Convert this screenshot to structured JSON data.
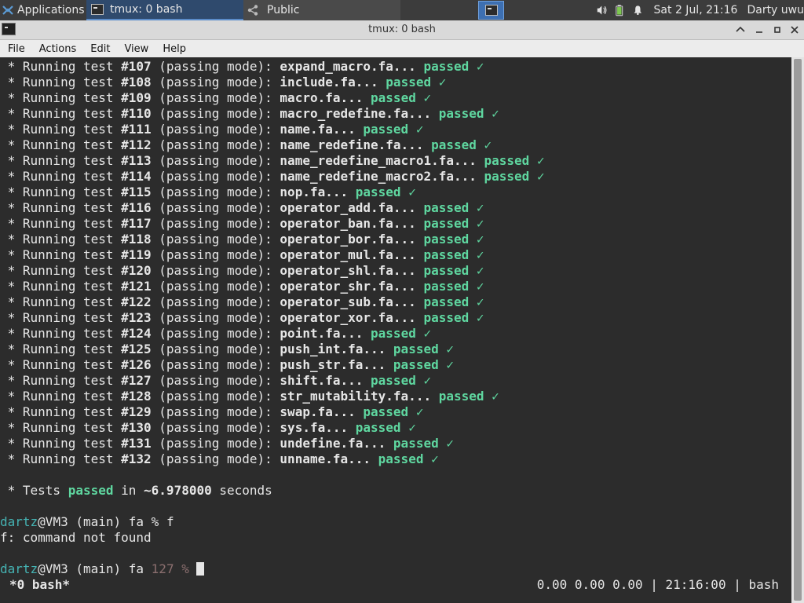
{
  "panel": {
    "apps_label": "Applications",
    "task1_label": "tmux: 0 bash",
    "task2_label": "Public",
    "clock": "Sat  2 Jul, 21:16",
    "user": "Darty uwu"
  },
  "window": {
    "title": "tmux: 0 bash"
  },
  "menubar": {
    "items": [
      "File",
      "Actions",
      "Edit",
      "View",
      "Help"
    ]
  },
  "tests": [
    {
      "num": "#107",
      "file": "expand_macro.fa..."
    },
    {
      "num": "#108",
      "file": "include.fa..."
    },
    {
      "num": "#109",
      "file": "macro.fa..."
    },
    {
      "num": "#110",
      "file": "macro_redefine.fa..."
    },
    {
      "num": "#111",
      "file": "name.fa..."
    },
    {
      "num": "#112",
      "file": "name_redefine.fa..."
    },
    {
      "num": "#113",
      "file": "name_redefine_macro1.fa..."
    },
    {
      "num": "#114",
      "file": "name_redefine_macro2.fa..."
    },
    {
      "num": "#115",
      "file": "nop.fa..."
    },
    {
      "num": "#116",
      "file": "operator_add.fa..."
    },
    {
      "num": "#117",
      "file": "operator_ban.fa..."
    },
    {
      "num": "#118",
      "file": "operator_bor.fa..."
    },
    {
      "num": "#119",
      "file": "operator_mul.fa..."
    },
    {
      "num": "#120",
      "file": "operator_shl.fa..."
    },
    {
      "num": "#121",
      "file": "operator_shr.fa..."
    },
    {
      "num": "#122",
      "file": "operator_sub.fa..."
    },
    {
      "num": "#123",
      "file": "operator_xor.fa..."
    },
    {
      "num": "#124",
      "file": "point.fa..."
    },
    {
      "num": "#125",
      "file": "push_int.fa..."
    },
    {
      "num": "#126",
      "file": "push_str.fa..."
    },
    {
      "num": "#127",
      "file": "shift.fa..."
    },
    {
      "num": "#128",
      "file": "str_mutability.fa..."
    },
    {
      "num": "#129",
      "file": "swap.fa..."
    },
    {
      "num": "#130",
      "file": "sys.fa..."
    },
    {
      "num": "#131",
      "file": "undefine.fa..."
    },
    {
      "num": "#132",
      "file": "unname.fa..."
    }
  ],
  "test_line": {
    "prefix": " * Running test ",
    "mode": " (passing mode): ",
    "status": "passed",
    "check": "✓"
  },
  "summary": {
    "prefix": " * Tests ",
    "passed": "passed",
    "mid": " in ",
    "time": "~6.978000",
    "suffix": " seconds"
  },
  "prompt1": {
    "user": "dartz",
    "host": "@VM3 (main) fa % ",
    "command": "f"
  },
  "error_line": "f: command not found",
  "prompt2": {
    "user": "dartz",
    "host": "@VM3 (main) fa ",
    "code": "127 %",
    "space": " "
  },
  "tmux_status": {
    "left": "*0 bash*",
    "right": "0.00 0.00 0.00 | 21:16:00 | bash"
  },
  "colors": {
    "accent": "#5fd7a0",
    "user": "#45b3b3"
  }
}
